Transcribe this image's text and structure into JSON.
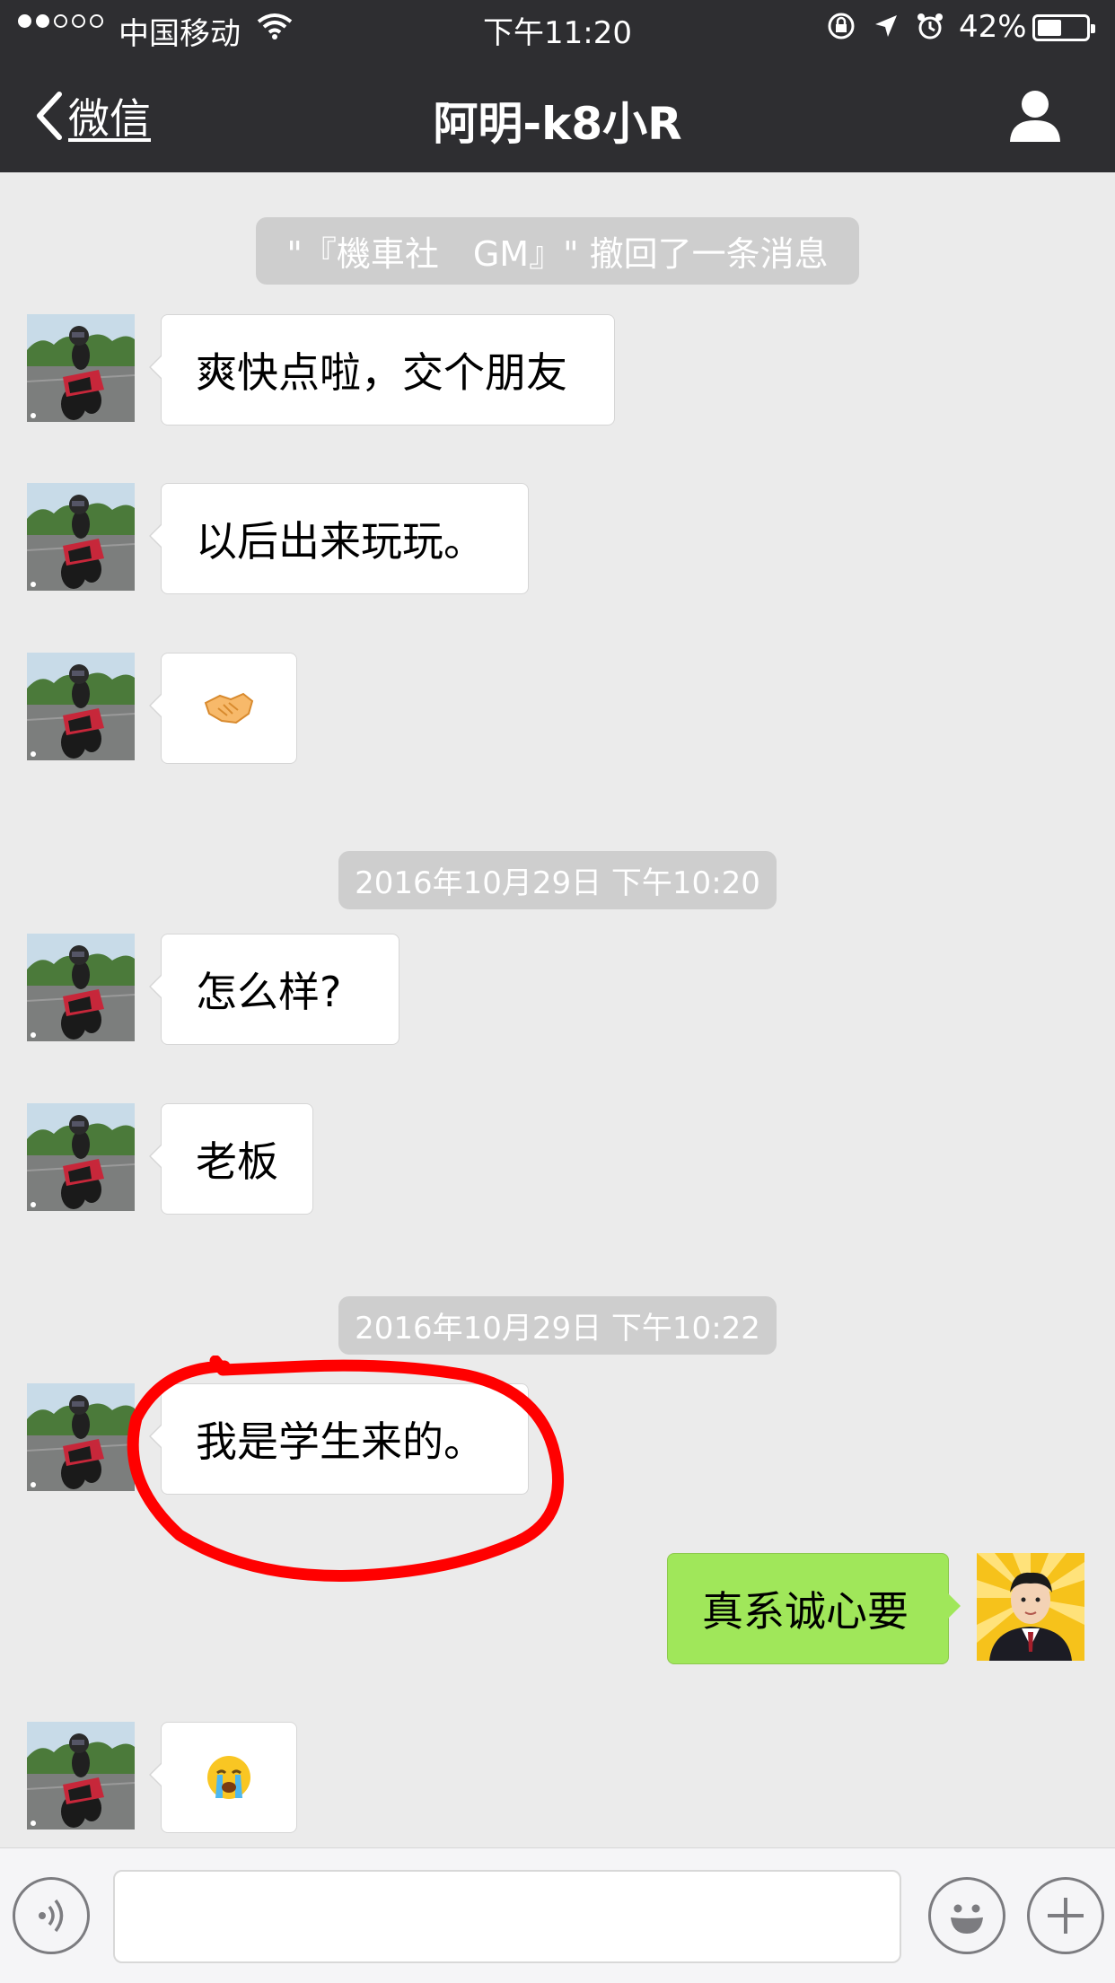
{
  "status_bar": {
    "carrier": "中国移动",
    "time": "下午11:20",
    "battery": "42%",
    "battery_level": 0.42,
    "signal_bars_filled": 2,
    "signal_bars_total": 5
  },
  "nav": {
    "back_label": "微信",
    "title": "阿明-k8小R"
  },
  "messages": {
    "recall_notice": "\"『機車社　GM』\" 撤回了一条消息",
    "m1": "爽快点啦，交个朋友",
    "m2": "以后出来玩玩。",
    "m3_emoji": "🤝",
    "ts1": "2016年10月29日 下午10:20",
    "m4": "怎么样?",
    "m5": "老板",
    "ts2": "2016年10月29日 下午10:22",
    "m6": "我是学生来的。",
    "m7": "真系诚心要",
    "m8_emoji": "😭"
  },
  "input_bar": {
    "input_value": ""
  },
  "colors": {
    "nav_bg": "#2e2e31",
    "chat_bg": "#ebebeb",
    "bubble_out": "#a0e75a",
    "bubble_in": "#ffffff",
    "annotation": "#ff0000"
  }
}
